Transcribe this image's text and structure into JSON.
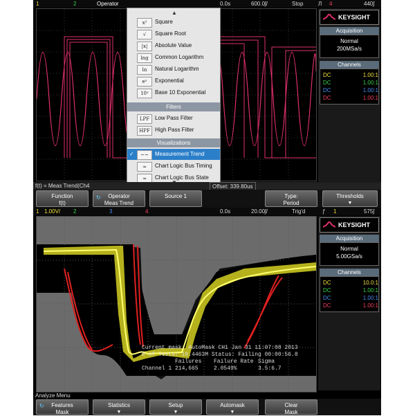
{
  "top": {
    "status": {
      "ch1": "1",
      "ch2": "2",
      "menu_title": "Operator",
      "time_pos": "0.0s",
      "time_scale": "600.0ʃ/",
      "run_state": "Stop",
      "trigger_sym": "Л",
      "trigger_ch": "4",
      "trigger_level": "440ʃ"
    },
    "operator_menu": {
      "items": [
        {
          "glyph": "x²",
          "label": "Square"
        },
        {
          "glyph": "√",
          "label": "Square Root"
        },
        {
          "glyph": "|x|",
          "label": "Absolute Value"
        },
        {
          "glyph": "lng",
          "label": "Common Logarithm"
        },
        {
          "glyph": "ln",
          "label": "Natural Logarithm"
        },
        {
          "glyph": "eˣ",
          "label": "Exponential"
        },
        {
          "glyph": "10ˣ",
          "label": "Base 10 Exponential"
        }
      ],
      "filters_header": "Filters",
      "filters": [
        {
          "glyph": "LPF",
          "label": "Low Pass Filter"
        },
        {
          "glyph": "HPF",
          "label": "High Pass Filter"
        }
      ],
      "visualizations_header": "Visualizations",
      "visualizations": [
        {
          "glyph": "~~",
          "label": "Measurement Trend",
          "selected": true
        },
        {
          "glyph": "≈",
          "label": "Chart Logic Bus Timing",
          "selected": false
        },
        {
          "glyph": "≈",
          "label": "Chart Logic Bus State",
          "selected": false
        }
      ]
    },
    "infobar": {
      "left": "f(t) = Meas Trend(Ch4",
      "right": "Offset: 339.80us"
    },
    "softkeys": [
      {
        "line1": "Function",
        "line2": "f(t)"
      },
      {
        "line1": "Operator",
        "line2": "Meas Trend"
      },
      {
        "line1": "Source 1",
        "line2": ""
      },
      {
        "line1": "Type:",
        "line2": "Period"
      },
      {
        "line1": "Thresholds",
        "line2": ""
      }
    ],
    "panel": {
      "brand": "KEYSIGHT",
      "acq_title": "Acquisition",
      "acq_mode": "Normal",
      "acq_rate": "200MSa/s",
      "channels_title": "Channels",
      "channels": [
        {
          "coupling": "DC",
          "ratio": "1.00:1",
          "color": "#f0e040"
        },
        {
          "coupling": "DC",
          "ratio": "1.00:1",
          "color": "#3cd24a"
        },
        {
          "coupling": "DC",
          "ratio": "1.00:1",
          "color": "#4a8cf0"
        },
        {
          "coupling": "DC",
          "ratio": "1.00:1",
          "color": "#f04060"
        }
      ]
    }
  },
  "bottom": {
    "status": {
      "ch1": "1",
      "ch1_scale": "1.00V/",
      "ch2": "2",
      "ch3": "3",
      "ch4": "4",
      "time_pos": "0.0s",
      "time_scale": "20.00ʃ/",
      "run_state": "Trig'd",
      "trigger_sym": "ƒ",
      "trigger_ch": "1",
      "trigger_level": "575ʃ"
    },
    "mask": {
      "line1": "Current mask: AutoMask CH1 Jan 31 11:07:08 2013",
      "line2": "# of Tests: 10.4463M  Status: Failing  00:00:56.8",
      "hdr_failures": "Failures",
      "hdr_rate": "Failure Rate",
      "hdr_sigma": "Sigma",
      "row_label": "Channel 1",
      "failures": "214,665",
      "rate": "2.0549%",
      "sigma": "3.5:6.7"
    },
    "menu_label": "Analyze Menu",
    "softkeys": [
      {
        "line1": "Features",
        "line2": "Mask"
      },
      {
        "line1": "Statistics",
        "line2": ""
      },
      {
        "line1": "Setup",
        "line2": ""
      },
      {
        "line1": "Automask",
        "line2": ""
      },
      {
        "line1": "Clear",
        "line2": "Mask"
      }
    ],
    "panel": {
      "brand": "KEYSIGHT",
      "acq_title": "Acquisition",
      "acq_mode": "Normal",
      "acq_rate": "5.00GSa/s",
      "channels_title": "Channels",
      "channels": [
        {
          "coupling": "DC",
          "ratio": "10.0:1",
          "color": "#f0e040"
        },
        {
          "coupling": "DC",
          "ratio": "1.00:1",
          "color": "#3cd24a"
        },
        {
          "coupling": "DC",
          "ratio": "1.00:1",
          "color": "#4a8cf0"
        },
        {
          "coupling": "DC",
          "ratio": "1.00:1",
          "color": "#f04060"
        }
      ]
    }
  }
}
